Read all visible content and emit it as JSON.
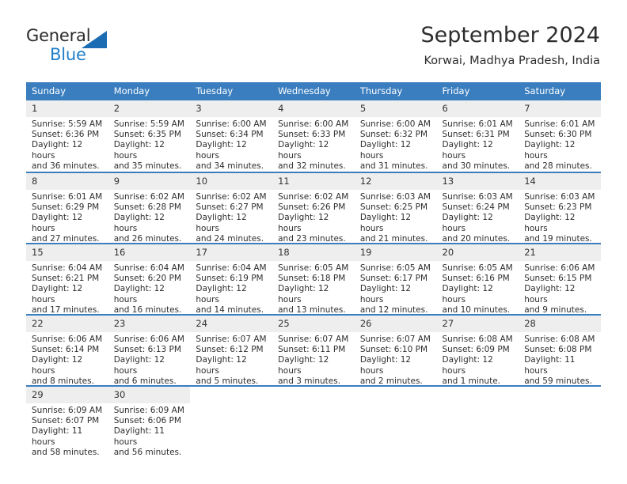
{
  "branding": {
    "name_part1": "General",
    "name_part2": "Blue",
    "triangle_color": "#1b6cb3",
    "blue_text_color": "#1f7ec8"
  },
  "header": {
    "title": "September 2024",
    "location": "Korwai, Madhya Pradesh, India"
  },
  "theme": {
    "header_row_bg": "#3a7ebf",
    "daynum_bg": "#eeeeee",
    "row_divider": "#3a7ebf",
    "text": "#2e2e2e"
  },
  "weekday_headers": [
    "Sunday",
    "Monday",
    "Tuesday",
    "Wednesday",
    "Thursday",
    "Friday",
    "Saturday"
  ],
  "weeks": [
    [
      {
        "day": "1",
        "sunrise": "Sunrise: 5:59 AM",
        "sunset": "Sunset: 6:36 PM",
        "daylight_1": "Daylight: 12 hours",
        "daylight_2": "and 36 minutes."
      },
      {
        "day": "2",
        "sunrise": "Sunrise: 5:59 AM",
        "sunset": "Sunset: 6:35 PM",
        "daylight_1": "Daylight: 12 hours",
        "daylight_2": "and 35 minutes."
      },
      {
        "day": "3",
        "sunrise": "Sunrise: 6:00 AM",
        "sunset": "Sunset: 6:34 PM",
        "daylight_1": "Daylight: 12 hours",
        "daylight_2": "and 34 minutes."
      },
      {
        "day": "4",
        "sunrise": "Sunrise: 6:00 AM",
        "sunset": "Sunset: 6:33 PM",
        "daylight_1": "Daylight: 12 hours",
        "daylight_2": "and 32 minutes."
      },
      {
        "day": "5",
        "sunrise": "Sunrise: 6:00 AM",
        "sunset": "Sunset: 6:32 PM",
        "daylight_1": "Daylight: 12 hours",
        "daylight_2": "and 31 minutes."
      },
      {
        "day": "6",
        "sunrise": "Sunrise: 6:01 AM",
        "sunset": "Sunset: 6:31 PM",
        "daylight_1": "Daylight: 12 hours",
        "daylight_2": "and 30 minutes."
      },
      {
        "day": "7",
        "sunrise": "Sunrise: 6:01 AM",
        "sunset": "Sunset: 6:30 PM",
        "daylight_1": "Daylight: 12 hours",
        "daylight_2": "and 28 minutes."
      }
    ],
    [
      {
        "day": "8",
        "sunrise": "Sunrise: 6:01 AM",
        "sunset": "Sunset: 6:29 PM",
        "daylight_1": "Daylight: 12 hours",
        "daylight_2": "and 27 minutes."
      },
      {
        "day": "9",
        "sunrise": "Sunrise: 6:02 AM",
        "sunset": "Sunset: 6:28 PM",
        "daylight_1": "Daylight: 12 hours",
        "daylight_2": "and 26 minutes."
      },
      {
        "day": "10",
        "sunrise": "Sunrise: 6:02 AM",
        "sunset": "Sunset: 6:27 PM",
        "daylight_1": "Daylight: 12 hours",
        "daylight_2": "and 24 minutes."
      },
      {
        "day": "11",
        "sunrise": "Sunrise: 6:02 AM",
        "sunset": "Sunset: 6:26 PM",
        "daylight_1": "Daylight: 12 hours",
        "daylight_2": "and 23 minutes."
      },
      {
        "day": "12",
        "sunrise": "Sunrise: 6:03 AM",
        "sunset": "Sunset: 6:25 PM",
        "daylight_1": "Daylight: 12 hours",
        "daylight_2": "and 21 minutes."
      },
      {
        "day": "13",
        "sunrise": "Sunrise: 6:03 AM",
        "sunset": "Sunset: 6:24 PM",
        "daylight_1": "Daylight: 12 hours",
        "daylight_2": "and 20 minutes."
      },
      {
        "day": "14",
        "sunrise": "Sunrise: 6:03 AM",
        "sunset": "Sunset: 6:23 PM",
        "daylight_1": "Daylight: 12 hours",
        "daylight_2": "and 19 minutes."
      }
    ],
    [
      {
        "day": "15",
        "sunrise": "Sunrise: 6:04 AM",
        "sunset": "Sunset: 6:21 PM",
        "daylight_1": "Daylight: 12 hours",
        "daylight_2": "and 17 minutes."
      },
      {
        "day": "16",
        "sunrise": "Sunrise: 6:04 AM",
        "sunset": "Sunset: 6:20 PM",
        "daylight_1": "Daylight: 12 hours",
        "daylight_2": "and 16 minutes."
      },
      {
        "day": "17",
        "sunrise": "Sunrise: 6:04 AM",
        "sunset": "Sunset: 6:19 PM",
        "daylight_1": "Daylight: 12 hours",
        "daylight_2": "and 14 minutes."
      },
      {
        "day": "18",
        "sunrise": "Sunrise: 6:05 AM",
        "sunset": "Sunset: 6:18 PM",
        "daylight_1": "Daylight: 12 hours",
        "daylight_2": "and 13 minutes."
      },
      {
        "day": "19",
        "sunrise": "Sunrise: 6:05 AM",
        "sunset": "Sunset: 6:17 PM",
        "daylight_1": "Daylight: 12 hours",
        "daylight_2": "and 12 minutes."
      },
      {
        "day": "20",
        "sunrise": "Sunrise: 6:05 AM",
        "sunset": "Sunset: 6:16 PM",
        "daylight_1": "Daylight: 12 hours",
        "daylight_2": "and 10 minutes."
      },
      {
        "day": "21",
        "sunrise": "Sunrise: 6:06 AM",
        "sunset": "Sunset: 6:15 PM",
        "daylight_1": "Daylight: 12 hours",
        "daylight_2": "and 9 minutes."
      }
    ],
    [
      {
        "day": "22",
        "sunrise": "Sunrise: 6:06 AM",
        "sunset": "Sunset: 6:14 PM",
        "daylight_1": "Daylight: 12 hours",
        "daylight_2": "and 8 minutes."
      },
      {
        "day": "23",
        "sunrise": "Sunrise: 6:06 AM",
        "sunset": "Sunset: 6:13 PM",
        "daylight_1": "Daylight: 12 hours",
        "daylight_2": "and 6 minutes."
      },
      {
        "day": "24",
        "sunrise": "Sunrise: 6:07 AM",
        "sunset": "Sunset: 6:12 PM",
        "daylight_1": "Daylight: 12 hours",
        "daylight_2": "and 5 minutes."
      },
      {
        "day": "25",
        "sunrise": "Sunrise: 6:07 AM",
        "sunset": "Sunset: 6:11 PM",
        "daylight_1": "Daylight: 12 hours",
        "daylight_2": "and 3 minutes."
      },
      {
        "day": "26",
        "sunrise": "Sunrise: 6:07 AM",
        "sunset": "Sunset: 6:10 PM",
        "daylight_1": "Daylight: 12 hours",
        "daylight_2": "and 2 minutes."
      },
      {
        "day": "27",
        "sunrise": "Sunrise: 6:08 AM",
        "sunset": "Sunset: 6:09 PM",
        "daylight_1": "Daylight: 12 hours",
        "daylight_2": "and 1 minute."
      },
      {
        "day": "28",
        "sunrise": "Sunrise: 6:08 AM",
        "sunset": "Sunset: 6:08 PM",
        "daylight_1": "Daylight: 11 hours",
        "daylight_2": "and 59 minutes."
      }
    ],
    [
      {
        "day": "29",
        "sunrise": "Sunrise: 6:09 AM",
        "sunset": "Sunset: 6:07 PM",
        "daylight_1": "Daylight: 11 hours",
        "daylight_2": "and 58 minutes."
      },
      {
        "day": "30",
        "sunrise": "Sunrise: 6:09 AM",
        "sunset": "Sunset: 6:06 PM",
        "daylight_1": "Daylight: 11 hours",
        "daylight_2": "and 56 minutes."
      },
      {
        "day": "",
        "sunrise": "",
        "sunset": "",
        "daylight_1": "",
        "daylight_2": ""
      },
      {
        "day": "",
        "sunrise": "",
        "sunset": "",
        "daylight_1": "",
        "daylight_2": ""
      },
      {
        "day": "",
        "sunrise": "",
        "sunset": "",
        "daylight_1": "",
        "daylight_2": ""
      },
      {
        "day": "",
        "sunrise": "",
        "sunset": "",
        "daylight_1": "",
        "daylight_2": ""
      },
      {
        "day": "",
        "sunrise": "",
        "sunset": "",
        "daylight_1": "",
        "daylight_2": ""
      }
    ]
  ]
}
